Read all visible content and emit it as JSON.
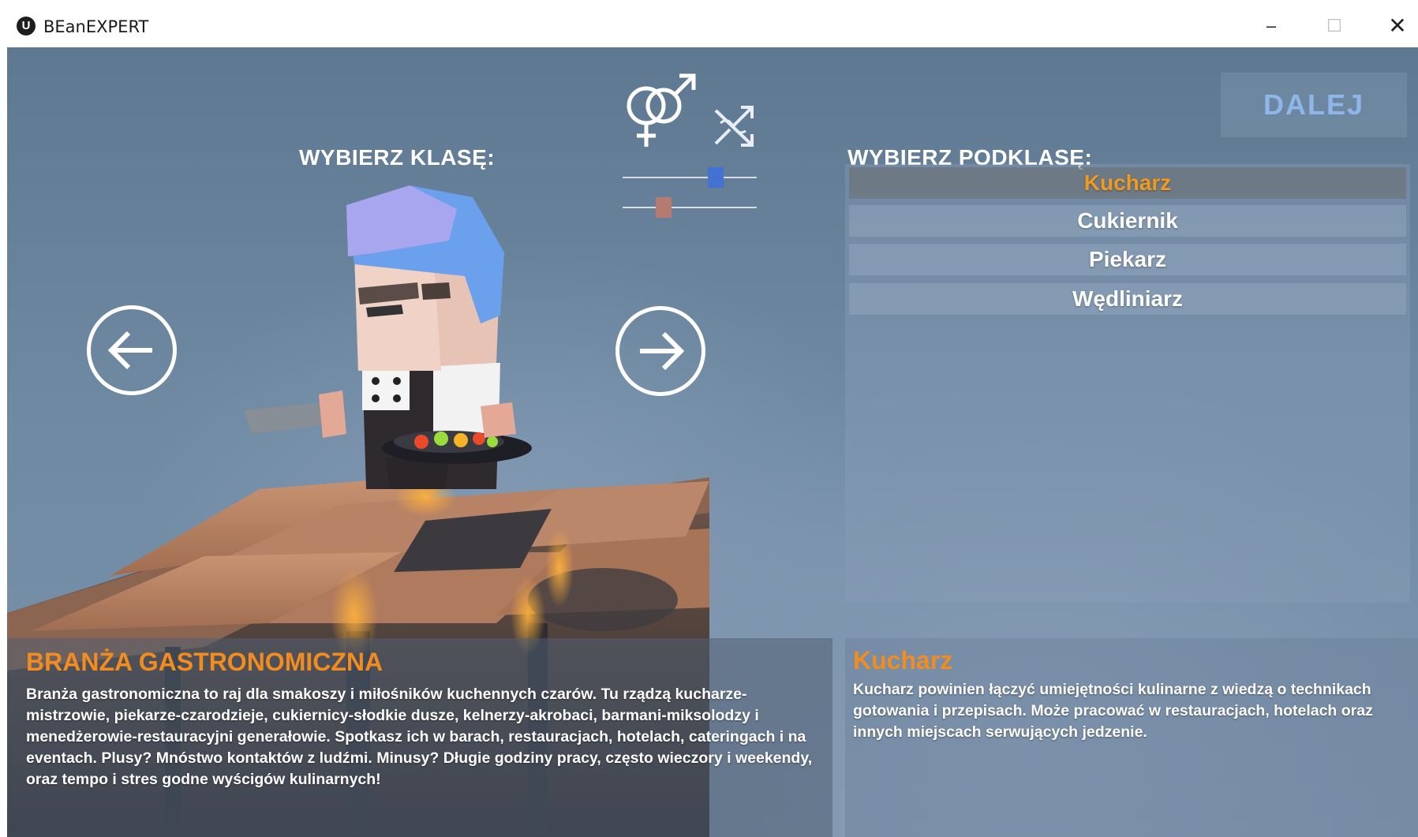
{
  "window": {
    "logo": "U",
    "title": "BEanEXPERT",
    "controls": {
      "minimize": "–",
      "maximize": "☐",
      "close": "✕"
    }
  },
  "header": {
    "class_label": "WYBIERZ KLASĘ:",
    "subclass_label": "WYBIERZ PODKLASĘ:",
    "next_button": "DALEJ"
  },
  "customization": {
    "gender_icon": "gender-symbols-icon",
    "randomize_icon": "randomize-icon",
    "slider_1_value": 0.72,
    "slider_2_value": 0.28
  },
  "subclasses": {
    "items": [
      {
        "label": "Kucharz",
        "selected": true
      },
      {
        "label": "Cukiernik",
        "selected": false
      },
      {
        "label": "Piekarz",
        "selected": false
      },
      {
        "label": "Wędliniarz",
        "selected": false
      }
    ]
  },
  "class_info": {
    "title": "BRANŻA GASTRONOMICZNA",
    "description": "Branża gastronomiczna to raj dla smakoszy i miłośników kuchennych czarów. Tu rządzą kucharze-mistrzowie, piekarze-czarodzieje, cukiernicy-słodkie dusze, kelnerzy-akrobaci, barmani-miksolodzy i menedżerowie-restauracyjni generałowie. Spotkasz ich w barach, restauracjach, hotelach, cateringach i na eventach. Plusy? Mnóstwo kontaktów z ludźmi. Minusy? Długie godziny pracy, często wieczory i weekendy, oraz tempo i stres godne wyścigów kulinarnych!"
  },
  "subclass_info": {
    "title": "Kucharz",
    "description": "Kucharz powinien łączyć umiejętności kulinarne z wiedzą o technikach gotowania i przepisach. Może pracować w restauracjach, hotelach oraz innych miejscach serwujących jedzenie."
  },
  "colors": {
    "accent_orange": "#f28c1f",
    "next_button_text": "#8fb6e8",
    "slider_1_thumb": "#4472d2",
    "slider_2_thumb": "#b77a70"
  }
}
